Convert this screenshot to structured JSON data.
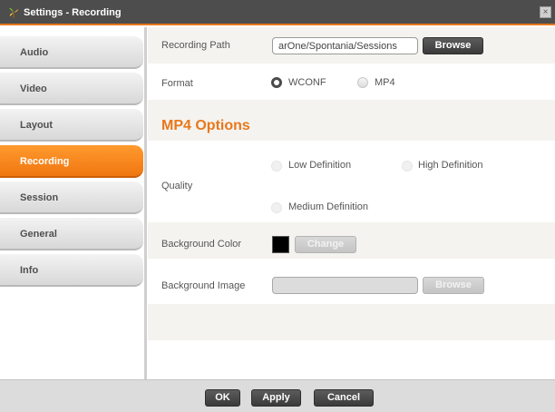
{
  "window": {
    "title": "Settings - Recording",
    "close_label": "×"
  },
  "sidebar": {
    "items": [
      {
        "label": "Audio"
      },
      {
        "label": "Video"
      },
      {
        "label": "Layout"
      },
      {
        "label": "Recording",
        "active": true
      },
      {
        "label": "Session"
      },
      {
        "label": "General"
      },
      {
        "label": "Info"
      }
    ]
  },
  "recording": {
    "path_label": "Recording Path",
    "path_value": "arOne/Spontania/Sessions",
    "browse_label": "Browse",
    "format_label": "Format",
    "format_options": [
      {
        "label": "WCONF",
        "selected": true
      },
      {
        "label": "MP4",
        "selected": false
      }
    ]
  },
  "mp4": {
    "title": "MP4 Options",
    "quality_label": "Quality",
    "quality_options": [
      "Low Definition",
      "High Definition",
      "Medium Definition"
    ],
    "bg_color_label": "Background Color",
    "bg_color_value": "#000000",
    "change_label": "Change",
    "bg_image_label": "Background Image",
    "bg_image_value": "",
    "bg_image_browse_label": "Browse"
  },
  "footer": {
    "ok_label": "OK",
    "apply_label": "Apply",
    "cancel_label": "Cancel"
  },
  "colors": {
    "accent": "#e8781c",
    "titlebar": "#4d4d4d",
    "button": "#4a4a4a"
  }
}
